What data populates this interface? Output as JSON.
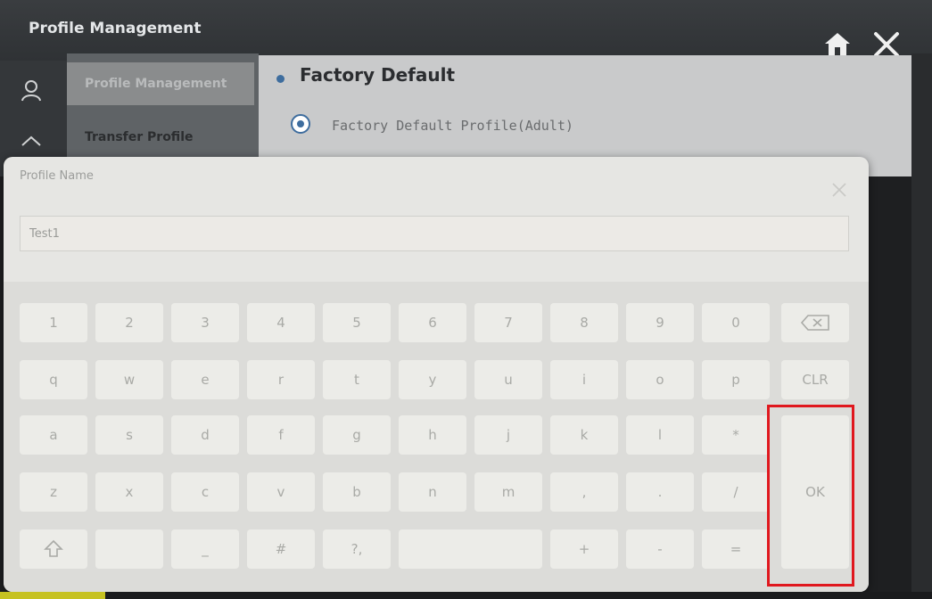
{
  "app": {
    "title": "Profile Management",
    "icons": {
      "home": "home-icon",
      "close": "close-icon"
    }
  },
  "sidebar": {
    "items": [
      {
        "label": "Profile Management",
        "active": true
      },
      {
        "label": "Transfer Profile"
      }
    ]
  },
  "panel": {
    "section_title": "Factory Default",
    "option_label": "Factory Default Profile(Adult)"
  },
  "dialog": {
    "title": "Profile Name",
    "input_value": "Test1"
  },
  "keyboard": {
    "rows": [
      [
        "1",
        "2",
        "3",
        "4",
        "5",
        "6",
        "7",
        "8",
        "9",
        "0",
        "⌫"
      ],
      [
        "q",
        "w",
        "e",
        "r",
        "t",
        "y",
        "u",
        "i",
        "o",
        "p",
        "CLR"
      ],
      [
        "a",
        "s",
        "d",
        "f",
        "g",
        "h",
        "j",
        "k",
        "l",
        "*"
      ],
      [
        "z",
        "x",
        "c",
        "v",
        "b",
        "n",
        "m",
        ",",
        ".",
        "/"
      ],
      [
        "⇧",
        "",
        "_",
        "#",
        "?,",
        "",
        "+",
        "-",
        "="
      ]
    ],
    "ok_label": "OK"
  },
  "colors": {
    "accent": "#3e6d9e",
    "highlight": "#e0181e"
  }
}
